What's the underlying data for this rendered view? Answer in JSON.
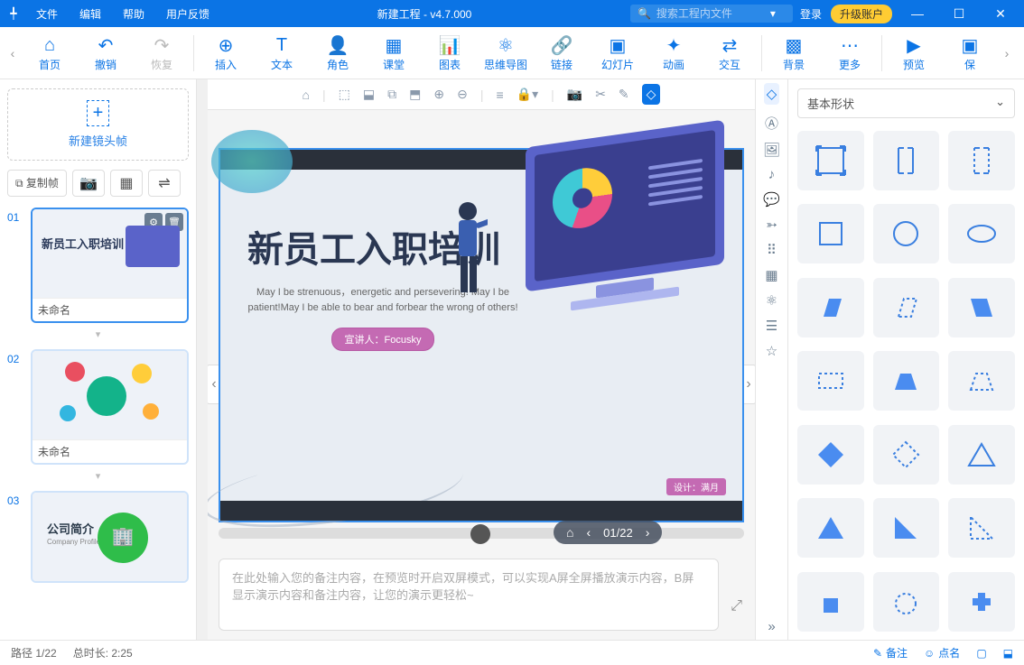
{
  "menu": {
    "file": "文件",
    "edit": "编辑",
    "help": "帮助",
    "feedback": "用户反馈"
  },
  "title": "新建工程 - v4.7.000",
  "search_placeholder": "搜索工程内文件",
  "login": "登录",
  "upgrade": "升级账户",
  "ribbon": {
    "home": "首页",
    "undo": "撤销",
    "redo": "恢复",
    "insert": "插入",
    "text": "文本",
    "role": "角色",
    "class": "课堂",
    "chart": "图表",
    "mindmap": "思维导图",
    "link": "链接",
    "slides": "幻灯片",
    "anim": "动画",
    "interact": "交互",
    "bg": "背景",
    "more": "更多",
    "preview": "预览",
    "save": "保"
  },
  "sidebar": {
    "new_frame": "新建镜头帧",
    "copy_frame": "复制帧",
    "slides": [
      {
        "num": "01",
        "name": "未命名"
      },
      {
        "num": "02",
        "name": "未命名"
      },
      {
        "num": "03",
        "name": ""
      }
    ],
    "company_intro": "公司简介",
    "company_en": "Company Profile"
  },
  "slide": {
    "title": "新员工入职培训",
    "subtitle": "May I be strenuous，energetic and persevering! May I be patient!May I be able to bear and forbear the wrong of others!",
    "presenter_label": "宣讲人：Focusky",
    "design": "设计：满月"
  },
  "playbar": {
    "page": "01/22"
  },
  "notes": {
    "placeholder": "在此处输入您的备注内容，在预览时开启双屏模式，可以实现A屏全屏播放演示内容，B屏显示演示内容和备注内容，让您的演示更轻松~"
  },
  "rpanel": {
    "category": "基本形状"
  },
  "status": {
    "path": "路径 1/22",
    "duration": "总时长: 2:25",
    "notes": "备注",
    "roll": "点名"
  }
}
